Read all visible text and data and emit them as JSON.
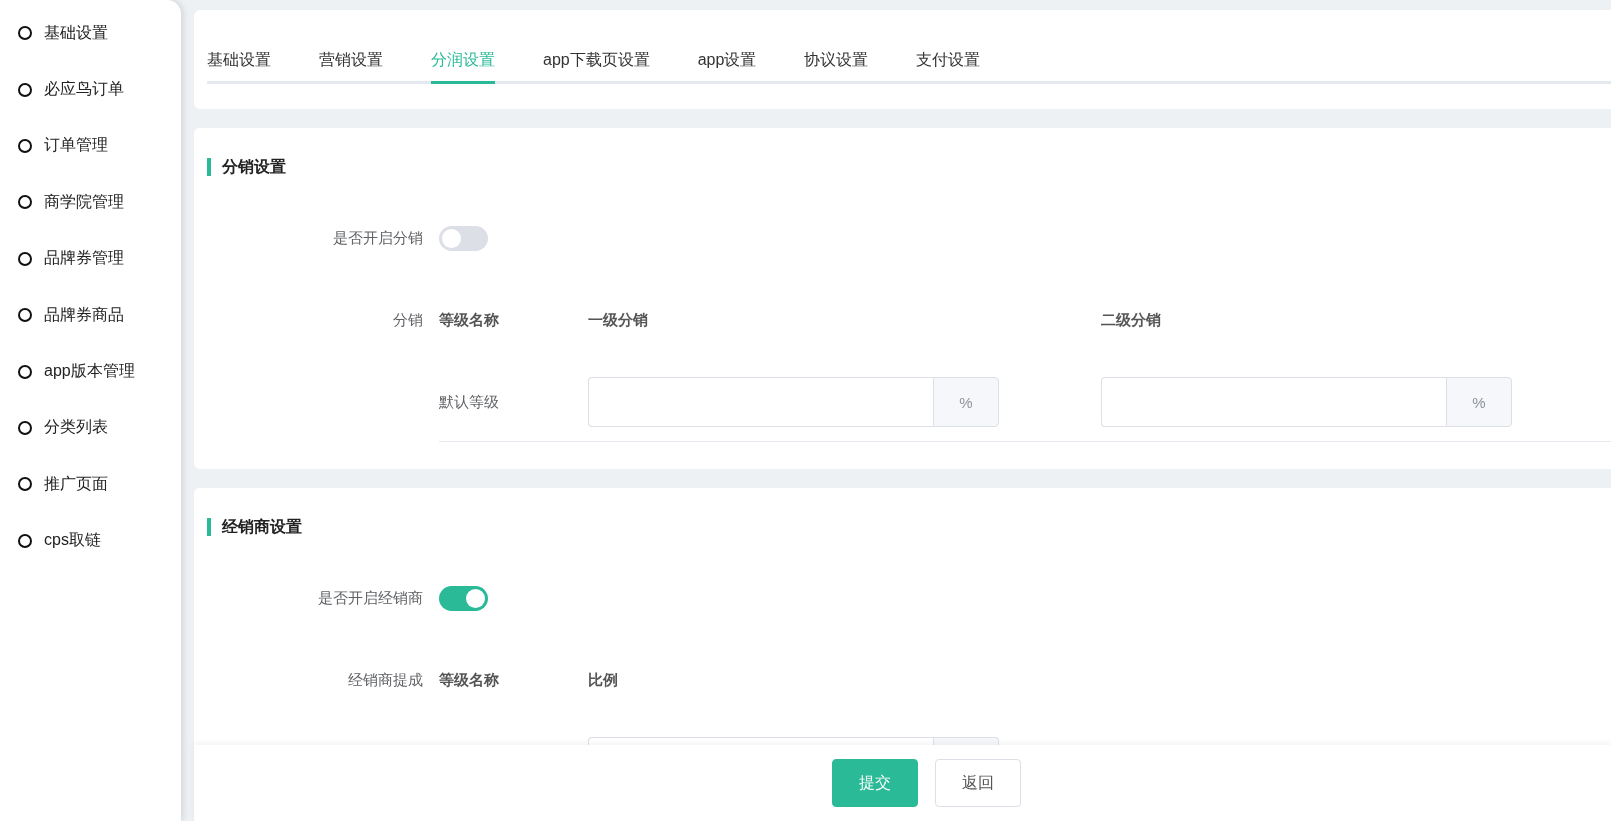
{
  "sidebar": {
    "items": [
      {
        "label": "基础设置"
      },
      {
        "label": "必应鸟订单"
      },
      {
        "label": "订单管理"
      },
      {
        "label": "商学院管理"
      },
      {
        "label": "品牌券管理"
      },
      {
        "label": "品牌券商品"
      },
      {
        "label": "app版本管理"
      },
      {
        "label": "分类列表"
      },
      {
        "label": "推广页面"
      },
      {
        "label": "cps取链"
      }
    ]
  },
  "tabs": [
    {
      "label": "基础设置",
      "selected": false
    },
    {
      "label": "营销设置",
      "selected": false
    },
    {
      "label": "分润设置",
      "selected": true
    },
    {
      "label": "app下载页设置",
      "selected": false
    },
    {
      "label": "app设置",
      "selected": false
    },
    {
      "label": "协议设置",
      "selected": false
    },
    {
      "label": "支付设置",
      "selected": false
    }
  ],
  "sections": [
    {
      "title": "分销设置",
      "switch": {
        "label": "是否开启分销",
        "on": false
      },
      "table_label": "分销",
      "columns": [
        "等级名称",
        "一级分销",
        "二级分销"
      ],
      "rows": [
        {
          "level_name": "默认等级",
          "inputs": [
            {
              "suffix": "%"
            },
            {
              "suffix": "%"
            }
          ]
        }
      ],
      "divider": true
    },
    {
      "title": "经销商设置",
      "switch": {
        "label": "是否开启经销商",
        "on": true
      },
      "table_label": "经销商提成",
      "columns": [
        "等级名称",
        "比例"
      ],
      "rows": [
        {
          "inputs": [
            {
              "cut": true
            }
          ]
        }
      ],
      "divider": false
    }
  ],
  "footer": {
    "buttons": [
      {
        "label": "提交",
        "kind": "primary"
      },
      {
        "label": "返回",
        "kind": "default"
      }
    ]
  }
}
